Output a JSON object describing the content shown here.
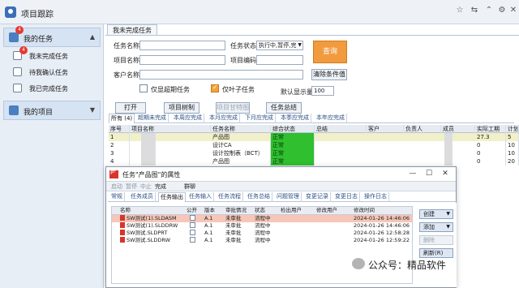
{
  "app": {
    "title": "项目跟踪",
    "window_controls": [
      "☆",
      "⇆",
      "⌃",
      "⚙",
      "✕"
    ]
  },
  "sidebar": {
    "my_tasks": {
      "label": "我的任务",
      "badge": "4",
      "arrow": "▲"
    },
    "items": [
      {
        "label": "我未完成任务",
        "badge": "4"
      },
      {
        "label": "待我确认任务",
        "badge": ""
      },
      {
        "label": "我已完成任务",
        "badge": ""
      }
    ],
    "my_projects": {
      "label": "我的项目",
      "arrow": "▼"
    }
  },
  "main": {
    "doc_tab": "我未完成任务",
    "filters": {
      "task_name_label": "任务名称",
      "task_status_label": "任务状态",
      "task_status_value": "执行中,暂停,完",
      "project_name_label": "项目名称",
      "project_code_label": "项目编码",
      "customer_name_label": "客户名称",
      "clear_button": "清除条件值",
      "only_overdue_label": "仅显超期任务",
      "only_leaf_label": "仅叶子任务",
      "only_leaf_checked": true,
      "page_size_label": "默认显示量",
      "page_size_value": "100",
      "query_button": "查询"
    },
    "buttons": {
      "open": "打开",
      "project_tree": "项目树制",
      "project_gantt": "项目甘特图",
      "task_summary": "任务总结"
    },
    "sub_tabs": [
      "所有 (4)",
      "超期未完成",
      "本周应完成",
      "本月应完成",
      "下月应完成",
      "本季应完成",
      "本年应完成"
    ],
    "grid": {
      "headers": [
        "序号",
        "项目名称",
        "任务名称",
        "综合状态",
        "总结",
        "客户",
        "负责人",
        "成员",
        "实际工期",
        "计划"
      ],
      "rows": [
        {
          "no": "1",
          "project": "",
          "task": "产品图",
          "status": "正常",
          "member": "",
          "actual": "27.3",
          "plan": "5"
        },
        {
          "no": "2",
          "project": "",
          "task": "设计CA",
          "status": "正常",
          "member": "",
          "actual": "0",
          "plan": "10"
        },
        {
          "no": "3",
          "project": "",
          "task": "设计控制表（BCT）",
          "status": "正常",
          "member": "",
          "actual": "0",
          "plan": "10"
        },
        {
          "no": "4",
          "project": "",
          "task": "产品图",
          "status": "正常",
          "member": "",
          "actual": "0",
          "plan": "20"
        }
      ]
    }
  },
  "dialog": {
    "title": "任务\"产品图\"的属性",
    "controls": [
      "—",
      "☐",
      "✕"
    ],
    "toolbar": [
      "启动",
      "暂停",
      "中止",
      "完成",
      "群聊"
    ],
    "tabs": [
      "常规",
      "任务成员",
      "任务输出",
      "任务输入",
      "任务流程",
      "任务总结",
      "问题管理",
      "变更记录",
      "变更日志",
      "操作日志"
    ],
    "active_tab": "任务输出",
    "grid": {
      "headers": [
        "名称",
        "公开",
        "版本",
        "审批情况",
        "状态",
        "检出用户",
        "修改用户",
        "修改时间"
      ],
      "rows": [
        {
          "name": "SW测试(1).SLDASM",
          "version": "A.1",
          "approval": "未审批",
          "state": "流程中",
          "modified": "2024-01-26 14:46:06"
        },
        {
          "name": "SW测试(1).SLDDRW",
          "version": "A.1",
          "approval": "未审批",
          "state": "流程中",
          "modified": "2024-01-26 14:46:06"
        },
        {
          "name": "SW测试.SLDPRT",
          "version": "A.1",
          "approval": "未审批",
          "state": "流程中",
          "modified": "2024-01-26 12:58:28"
        },
        {
          "name": "SW测试.SLDDRW",
          "version": "A.1",
          "approval": "未审批",
          "state": "流程中",
          "modified": "2024-01-26 12:59:22"
        }
      ]
    },
    "side_buttons": {
      "create": "创建",
      "add": "添加",
      "delete": "删除",
      "refresh": "刷新(R)"
    }
  },
  "watermark": "公众号：精品软件",
  "colors": {
    "accent": "#3b6fb6",
    "query": "#f19a3e",
    "status_ok": "#2fbf2f",
    "badge": "#e8382f",
    "selected_row": "#f7c6b8"
  }
}
